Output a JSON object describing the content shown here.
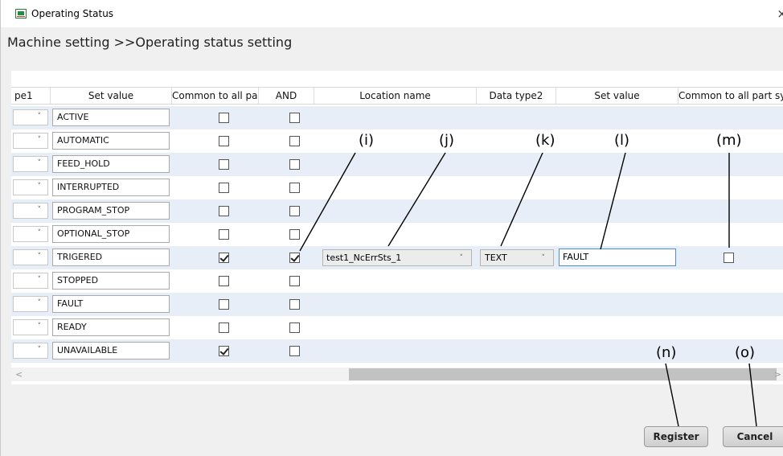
{
  "window": {
    "title": "Operating Status",
    "close_glyph": "×"
  },
  "breadcrumb": "Machine setting >>Operating status setting",
  "headers": {
    "data_type1": "pe1",
    "set_value": "Set value",
    "common": "Common to all part sy",
    "and": "AND",
    "location": "Location name",
    "data_type2": "Data type2",
    "set_value2": "Set value",
    "common2": "Common to all part sy"
  },
  "rows": [
    {
      "value": "ACTIVE",
      "common": false,
      "and": false
    },
    {
      "value": "AUTOMATIC",
      "common": false,
      "and": false
    },
    {
      "value": "FEED_HOLD",
      "common": false,
      "and": false
    },
    {
      "value": "INTERRUPTED",
      "common": false,
      "and": false
    },
    {
      "value": "PROGRAM_STOP",
      "common": false,
      "and": false
    },
    {
      "value": "OPTIONAL_STOP",
      "common": false,
      "and": false
    },
    {
      "value": "TRIGERED",
      "common": true,
      "and": true,
      "location": "test1_NcErrSts_1",
      "data_type2": "TEXT",
      "set_value2": "FAULT",
      "common2": false
    },
    {
      "value": "STOPPED",
      "common": false,
      "and": false
    },
    {
      "value": "FAULT",
      "common": false,
      "and": false
    },
    {
      "value": "READY",
      "common": false,
      "and": false
    },
    {
      "value": "UNAVAILABLE",
      "common": true,
      "and": false
    }
  ],
  "scrollbar": {
    "left": "<",
    "right": ">"
  },
  "buttons": {
    "register": "Register",
    "cancel": "Cancel"
  },
  "callouts": {
    "i": "(i)",
    "j": "(j)",
    "k": "(k)",
    "l": "(l)",
    "m": "(m)",
    "n": "(n)",
    "o": "(o)"
  },
  "icons": {
    "chevron": "chevron-down-icon",
    "app": "app-icon",
    "close": "close-icon"
  }
}
